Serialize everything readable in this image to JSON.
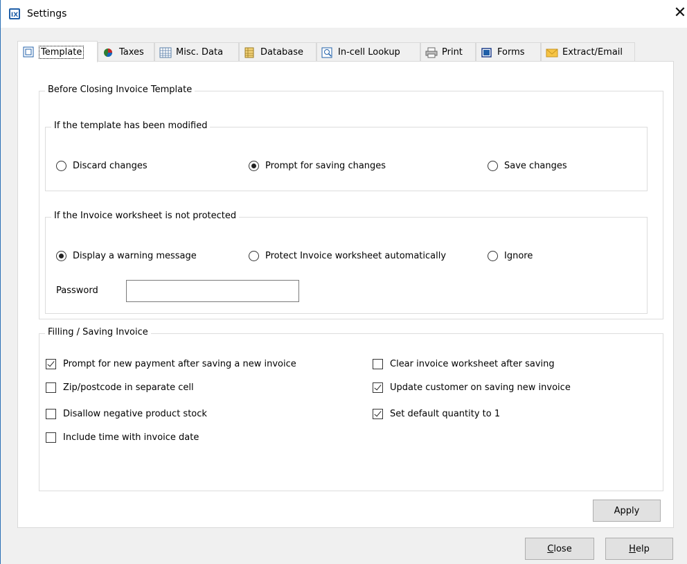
{
  "window": {
    "title": "Settings",
    "close_glyph": "✕",
    "icon": "app-icon"
  },
  "tabs": [
    {
      "label": "Template",
      "icon": "template-icon",
      "active": true
    },
    {
      "label": "Taxes",
      "icon": "pie-chart-icon",
      "active": false
    },
    {
      "label": "Misc. Data",
      "icon": "calendar-grid-icon",
      "active": false
    },
    {
      "label": "Database",
      "icon": "database-icon",
      "active": false
    },
    {
      "label": "In-cell Lookup",
      "icon": "lookup-icon",
      "active": false
    },
    {
      "label": "Print",
      "icon": "printer-icon",
      "active": false
    },
    {
      "label": "Forms",
      "icon": "form-icon",
      "active": false
    },
    {
      "label": "Extract/Email",
      "icon": "envelope-icon",
      "active": false
    }
  ],
  "closing": {
    "legend": "Before Closing Invoice Template",
    "modified": {
      "legend": "If the template has been modified",
      "options": [
        {
          "label": "Discard changes",
          "selected": false
        },
        {
          "label": "Prompt for saving changes",
          "selected": true
        },
        {
          "label": "Save changes",
          "selected": false
        }
      ]
    },
    "protected": {
      "legend": "If the Invoice worksheet is not protected",
      "options": [
        {
          "label": "Display a warning message",
          "selected": true
        },
        {
          "label": "Protect Invoice worksheet automatically",
          "selected": false
        },
        {
          "label": "Ignore",
          "selected": false
        }
      ],
      "password_label": "Password",
      "password_value": ""
    }
  },
  "filling": {
    "legend": "Filling / Saving Invoice",
    "left": [
      {
        "label": "Prompt for new payment after saving a new invoice",
        "checked": true
      },
      {
        "label": "Zip/postcode in separate cell",
        "checked": false
      },
      {
        "label": "Disallow negative product stock",
        "checked": false
      },
      {
        "label": "Include time with invoice date",
        "checked": false
      }
    ],
    "right": [
      {
        "label": "Clear invoice worksheet after saving",
        "checked": false
      },
      {
        "label": "Update customer on saving new invoice",
        "checked": true
      },
      {
        "label": "Set default quantity to 1",
        "checked": true
      }
    ]
  },
  "buttons": {
    "apply": "Apply",
    "close_pre": "",
    "close_key": "C",
    "close_post": "lose",
    "help_pre": "",
    "help_key": "H",
    "help_post": "elp"
  },
  "colors": {
    "window_border": "#2b6fb5",
    "dialog_bg": "#f0f0f0",
    "button_bg": "#e1e1e1"
  }
}
